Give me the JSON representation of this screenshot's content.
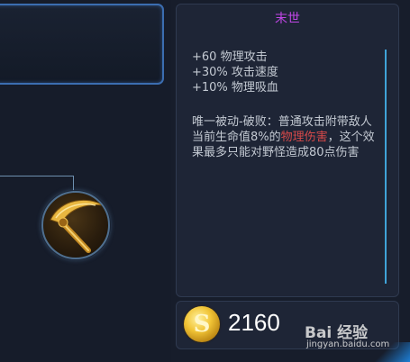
{
  "item": {
    "name": "末世",
    "stats": [
      "+60 物理攻击",
      "+30% 攻击速度",
      "+10% 物理吸血"
    ],
    "passive": {
      "part1": "唯一被动-破败：普通攻击附带敌人当前生命值8%的",
      "highlight": "物理伤害",
      "part2": "，这个效果最多只能对野怪造成80点伤害"
    },
    "price": "2160",
    "coin_symbol": "S"
  },
  "watermark": {
    "main": "Bai 经验",
    "sub": "jingyan.baidu.com"
  },
  "colors": {
    "title": "#c046e6",
    "highlight": "#d84a4a",
    "accent": "#3fa3d8"
  }
}
